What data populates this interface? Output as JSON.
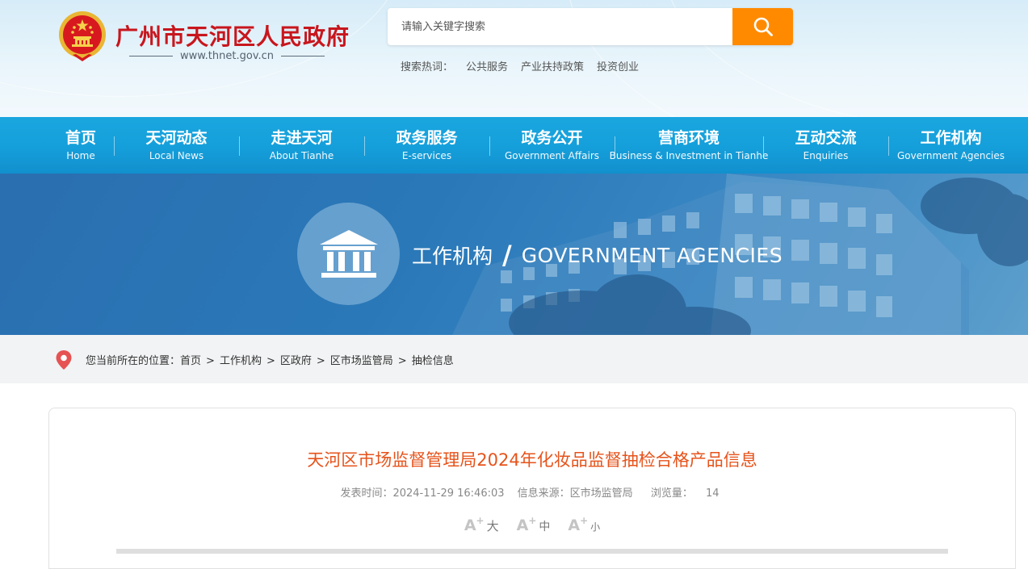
{
  "header": {
    "site_name": "广州市天河区人民政府",
    "site_url": "www.thnet.gov.cn",
    "search": {
      "placeholder": "请输入关键字搜索",
      "button_icon": "search-icon"
    },
    "hot_label": "搜索热词：",
    "hot_words": [
      "公共服务",
      "产业扶持政策",
      "投资创业"
    ]
  },
  "nav": [
    {
      "zh": "首页",
      "en": "Home"
    },
    {
      "zh": "天河动态",
      "en": "Local News"
    },
    {
      "zh": "走进天河",
      "en": "About Tianhe"
    },
    {
      "zh": "政务服务",
      "en": "E-services"
    },
    {
      "zh": "政务公开",
      "en": "Government Affairs"
    },
    {
      "zh": "营商环境",
      "en": "Business & Investment in Tianhe"
    },
    {
      "zh": "互动交流",
      "en": "Enquiries"
    },
    {
      "zh": "工作机构",
      "en": "Government Agencies"
    }
  ],
  "banner": {
    "title_zh": "工作机构",
    "slash": "/",
    "title_en": "GOVERNMENT AGENCIES",
    "icon": "building-icon"
  },
  "breadcrumb": {
    "prefix": "您当前所在的位置：",
    "items": [
      "首页",
      "工作机构",
      "区政府",
      "区市场监管局",
      "抽检信息"
    ],
    "separator": ">"
  },
  "article": {
    "title": "天河区市场监督管理局2024年化妆品监督抽检合格产品信息",
    "meta": {
      "publish_time": "发表时间：2024-11-29 16:46:03",
      "source": "信息来源：区市场监管局",
      "views_label": "浏览量：",
      "views": "14"
    },
    "font_sizes": [
      {
        "a": "A",
        "plus": "+",
        "label": "大"
      },
      {
        "a": "A",
        "plus": "+",
        "label": "中"
      },
      {
        "a": "A",
        "plus": "+",
        "label": "小"
      }
    ]
  },
  "colors": {
    "brand_red": "#c8161d",
    "nav_blue": "#15a0db",
    "search_orange": "#ff8a00",
    "title_orange": "#e6531b"
  }
}
